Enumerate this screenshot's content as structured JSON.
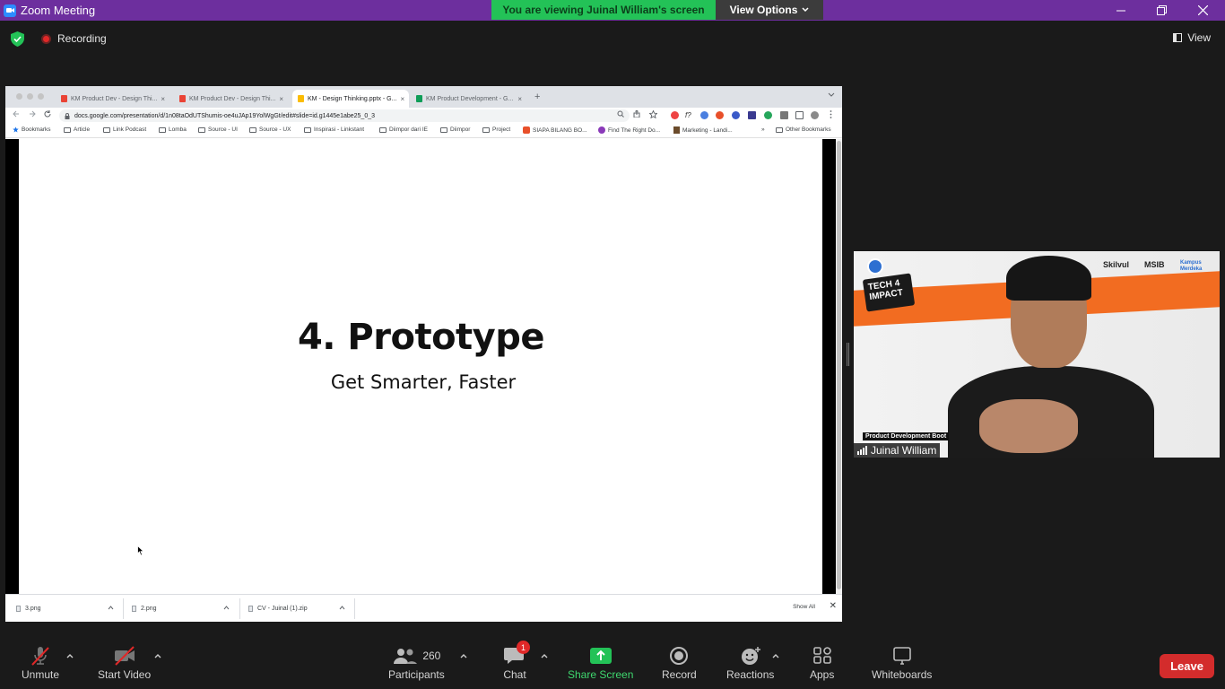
{
  "window": {
    "title": "Zoom Meeting",
    "minimize": "—",
    "restore": "❐",
    "close": "✕"
  },
  "banner": {
    "viewing": "You are viewing Juinal William's screen",
    "view_options": "View Options",
    "view_options_caret": "⌄"
  },
  "status": {
    "recording": "Recording",
    "view": "View"
  },
  "browser": {
    "tabs": [
      {
        "label": "KM Product Dev - Design Thi...",
        "fav_color": "#ea4335"
      },
      {
        "label": "KM Product Dev - Design Thi...",
        "fav_color": "#ea4335"
      },
      {
        "label": "KM - Design Thinking.pptx - G...",
        "fav_color": "#fbbc04",
        "active": true
      },
      {
        "label": "KM Product Development - G...",
        "fav_color": "#0f9d58"
      }
    ],
    "tab_close": "×",
    "new_tab": "+",
    "url": "docs.google.com/presentation/d/1n08taOdUTShumis-oe4uJAp19YolWgGt/edit#slide=id.g1445e1abe25_0_3",
    "bookmarks": [
      "Bookmarks",
      "Article",
      "Link Podcast",
      "Lomba",
      "Source - UI",
      "Source - UX",
      "Inspirasi - Linkstant",
      "Diimpor dari IE",
      "Diimpor",
      "Project",
      "SIAPA BILANG BO...",
      "Find The Right Do...",
      "Marketing - Landi..."
    ],
    "bookmarks_more": "»",
    "other_bookmarks": "Other Bookmarks",
    "slide": {
      "title": "4. Prototype",
      "subtitle": "Get Smarter, Faster"
    },
    "downloads": [
      "3.png",
      "2.png",
      "CV - Juinal (1).zip"
    ],
    "show_all": "Show All",
    "download_close": "✕"
  },
  "video": {
    "name": "Juinal William",
    "caption": "Product Development Boot",
    "badge": "TECH 4 IMPACT",
    "logos": [
      "Skilvul",
      "MSIB",
      "Kampus Merdeka"
    ]
  },
  "toolbar": {
    "unmute": "Unmute",
    "start_video": "Start Video",
    "participants_count": "260",
    "participants": "Participants",
    "chat": "Chat",
    "chat_badge": "1",
    "share_screen": "Share Screen",
    "record": "Record",
    "reactions": "Reactions",
    "apps": "Apps",
    "whiteboards": "Whiteboards",
    "leave": "Leave"
  },
  "colors": {
    "title_bar": "#6d2f9e",
    "banner_green": "#23c257",
    "leave_red": "#d32c2c",
    "share_green": "#23c257"
  }
}
